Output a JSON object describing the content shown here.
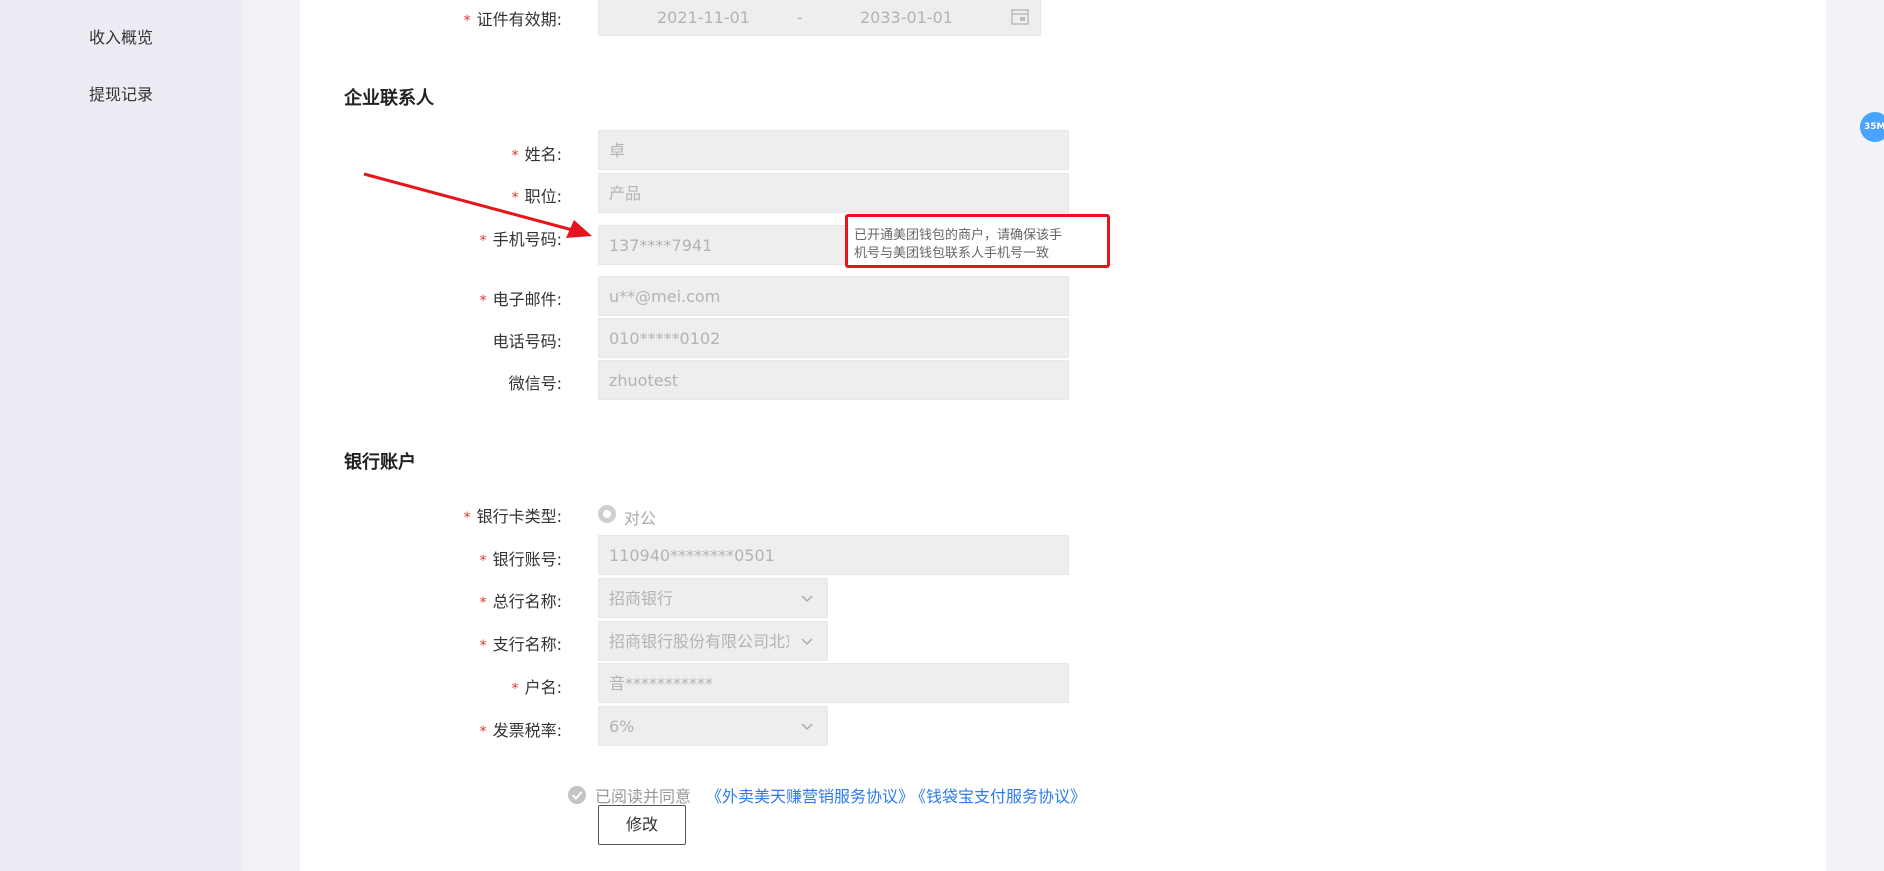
{
  "sidebar": {
    "items": [
      {
        "label": "收入概览"
      },
      {
        "label": "提现记录"
      }
    ]
  },
  "certificate": {
    "label": "证件有效期:",
    "start": "2021-11-01",
    "separator": "-",
    "end": "2033-01-01"
  },
  "contact": {
    "title": "企业联系人",
    "fields": {
      "name": {
        "label": "姓名:",
        "value": "卓"
      },
      "position": {
        "label": "职位:",
        "value": "产品"
      },
      "mobile": {
        "label": "手机号码:",
        "value": "137****7941"
      },
      "email": {
        "label": "电子邮件:",
        "value": "u**@mei.com"
      },
      "phone": {
        "label": "电话号码:",
        "value": "010*****0102"
      },
      "wechat": {
        "label": "微信号:",
        "value": "zhuotest"
      }
    },
    "mobile_tip": {
      "line1": "已开通美团钱包的商户，请确保该手",
      "line2": "机号与美团钱包联系人手机号一致"
    }
  },
  "bank": {
    "title": "银行账户",
    "fields": {
      "card_type": {
        "label": "银行卡类型:",
        "value": "对公"
      },
      "account": {
        "label": "银行账号:",
        "value": "110940********0501"
      },
      "head_bank": {
        "label": "总行名称:",
        "value": "招商银行"
      },
      "branch": {
        "label": "支行名称:",
        "value": "招商银行股份有限公司北京"
      },
      "account_name": {
        "label": "户名:",
        "value": "音***********"
      },
      "tax_rate": {
        "label": "发票税率:",
        "value": "6%"
      }
    }
  },
  "agreement": {
    "text": "已阅读并同意",
    "link1": "《外卖美天赚营销服务协议》",
    "link2": "《钱袋宝支付服务协议》"
  },
  "actions": {
    "edit_label": "修改"
  },
  "floating_badge": "35M",
  "colors": {
    "required": "#e0352b",
    "link": "#2f7bea",
    "highlight_border": "#e5161b",
    "arrow": "#e5161b"
  }
}
